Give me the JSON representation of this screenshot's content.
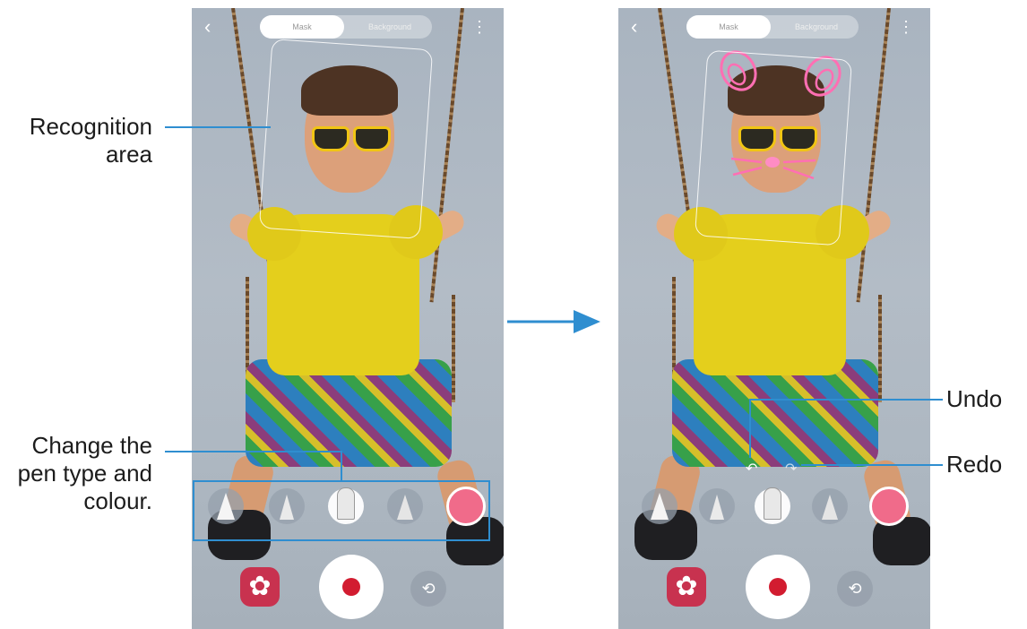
{
  "annotations": {
    "recognition_area": "Recognition area",
    "recognition_line1": "Recognition",
    "recognition_line2": "area",
    "pen_line1": "Change the",
    "pen_line2": "pen type and",
    "pen_line3": "colour.",
    "undo": "Undo",
    "redo": "Redo"
  },
  "screens": [
    {
      "name": "before-drawing",
      "top_tabs": [
        {
          "label": "Mask"
        },
        {
          "label": "Background"
        }
      ],
      "more_icon": "more-vert-icon",
      "back_icon": "chevron-left-icon"
    },
    {
      "name": "after-drawing",
      "top_tabs": [
        {
          "label": "Mask"
        },
        {
          "label": "Background"
        }
      ],
      "drawing": "bunny-ears-whiskers",
      "drawing_color": "#ff66aa"
    }
  ],
  "pen_types": [
    "fountain-pen-icon",
    "marker-icon",
    "highlighter-icon",
    "calligraphy-icon"
  ],
  "selected_pen": "highlighter-icon",
  "selected_color": "#f06b8a",
  "accent_color": "#2f8ed0",
  "controls": {
    "filter_icon": "flower-icon",
    "record_icon": "record-dot-icon",
    "switch_icon": "switch-camera-icon",
    "undo_icon": "undo-icon",
    "redo_icon": "redo-icon"
  },
  "flow_arrow": "arrow-right-icon"
}
